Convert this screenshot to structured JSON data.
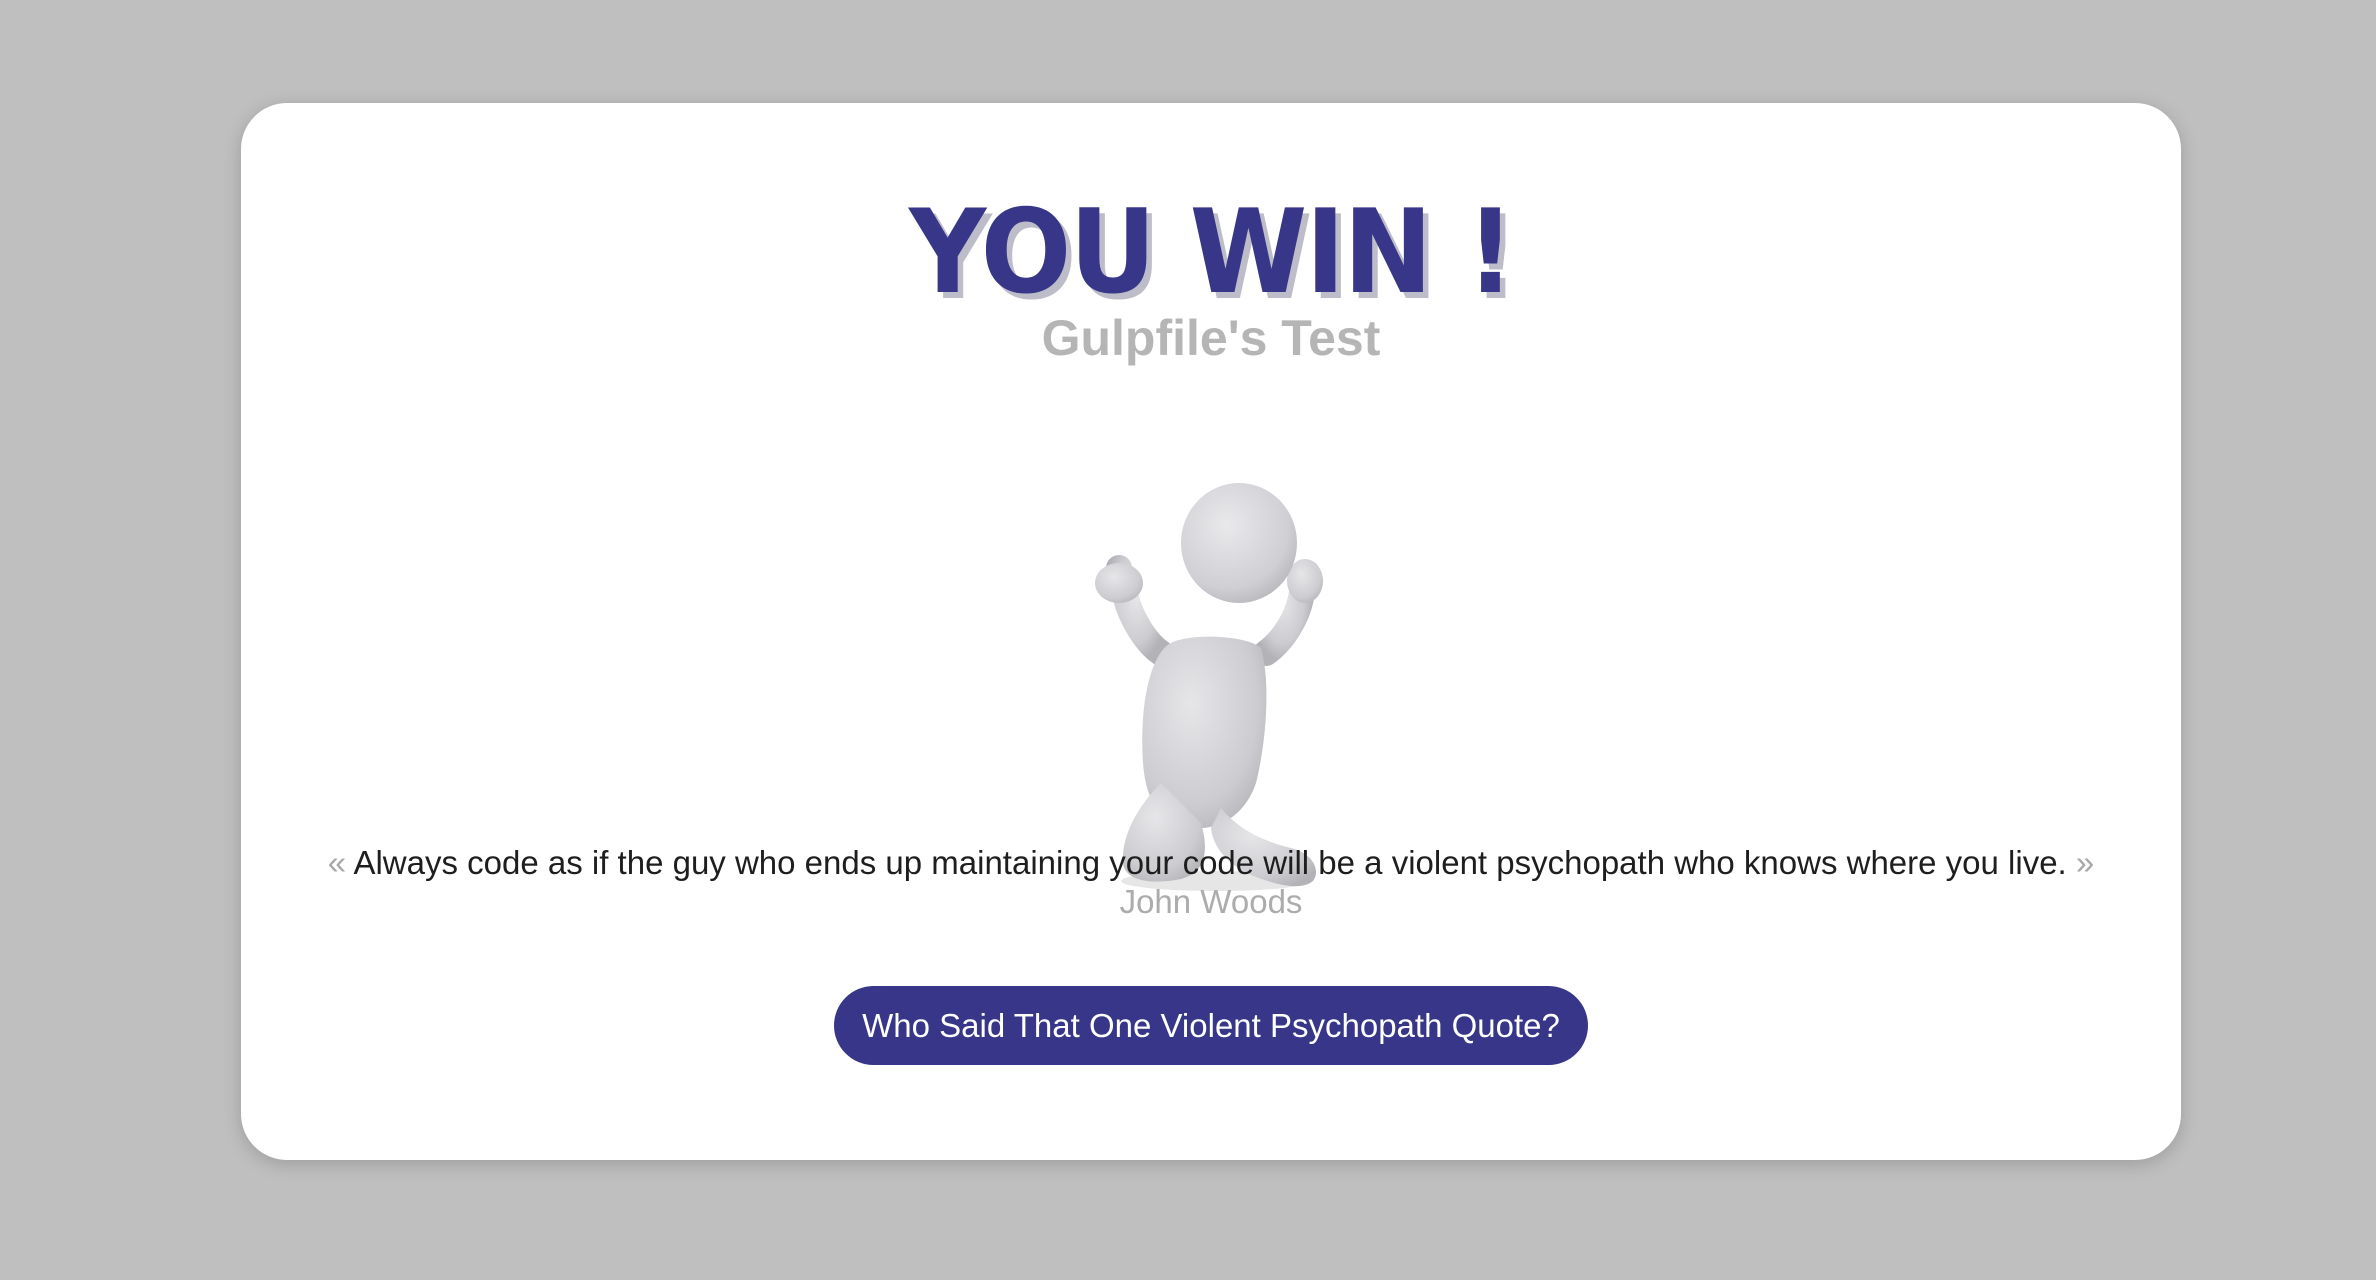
{
  "card": {
    "title": "YOU WIN !",
    "subtitle": "Gulpfile's Test",
    "image_icon": "kneeling-victory-figure",
    "quote": {
      "open_mark": "«",
      "text": "Always code as if the guy who ends up maintaining your code will be a violent psychopath who knows where you live.",
      "close_mark": "»",
      "author": "John Woods"
    },
    "button_label": "Who Said That One Violent Psychopath Quote?"
  },
  "colors": {
    "background": "#bfbfbf",
    "card": "#ffffff",
    "accent": "#373688",
    "muted_text": "#b5b5b5"
  }
}
